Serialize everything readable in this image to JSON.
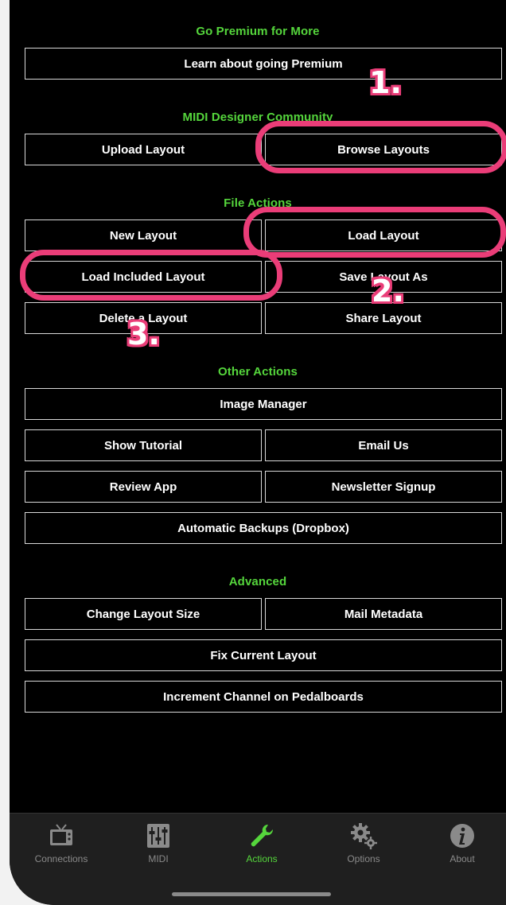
{
  "sections": {
    "premium": "Go Premium for More",
    "community": "MIDI Designer Community",
    "file_actions": "File Actions",
    "other_actions": "Other Actions",
    "advanced": "Advanced"
  },
  "buttons": {
    "learn_premium": "Learn about going Premium",
    "upload_layout": "Upload Layout",
    "browse_layouts": "Browse Layouts",
    "new_layout": "New Layout",
    "load_layout": "Load Layout",
    "load_included_layout": "Load Included Layout",
    "save_layout_as": "Save Layout As",
    "delete_layout": "Delete a Layout",
    "share_layout": "Share Layout",
    "image_manager": "Image Manager",
    "show_tutorial": "Show Tutorial",
    "email_us": "Email Us",
    "review_app": "Review App",
    "newsletter_signup": "Newsletter Signup",
    "automatic_backups": "Automatic Backups (Dropbox)",
    "change_layout_size": "Change Layout Size",
    "mail_metadata": "Mail Metadata",
    "fix_current_layout": "Fix Current Layout",
    "increment_channel": "Increment Channel on Pedalboards"
  },
  "annotations": {
    "marker_1": "1.",
    "marker_2": "2.",
    "marker_3": "3.",
    "color": "#ea3d78"
  },
  "tabbar": {
    "connections": "Connections",
    "midi": "MIDI",
    "actions": "Actions",
    "options": "Options",
    "about": "About",
    "active_tab": "Actions"
  },
  "colors": {
    "accent_green": "#55d63c",
    "background": "#000000",
    "button_border": "#d9d9d9"
  },
  "icons": {
    "connections": "tv-icon",
    "midi": "mixer-sliders-icon",
    "actions": "wrench-icon",
    "options": "gears-icon",
    "about": "info-icon"
  }
}
